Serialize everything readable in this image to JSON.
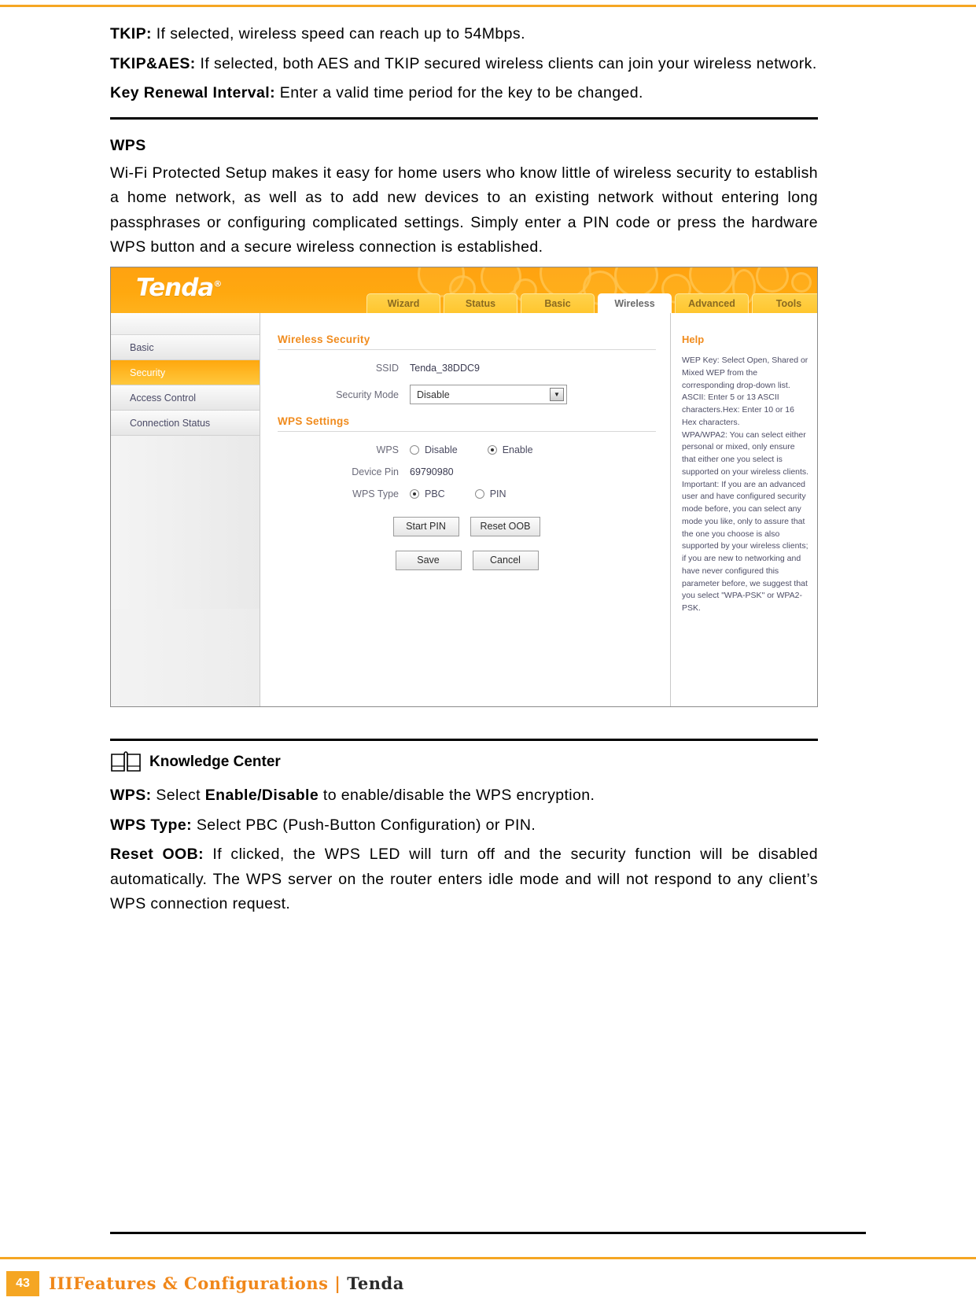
{
  "document": {
    "page_number": "43",
    "footer_prefix": "III",
    "footer_orange": "Features & Configurations",
    "footer_separator": "|",
    "footer_dark": "Tenda"
  },
  "intro": {
    "tkip_term": "TKIP:",
    "tkip_text": " If selected, wireless speed can reach up to 54Mbps.",
    "tkipaes_term": "TKIP&AES:",
    "tkipaes_text": " If selected, both AES and TKIP secured wireless clients can join your wireless network.",
    "key_renewal_term": "Key Renewal Interval:",
    "key_renewal_text": " Enter a valid time period for the key to be changed."
  },
  "wps_section": {
    "heading": "WPS",
    "body": "Wi-Fi Protected Setup makes it easy for home users who know little of wireless security to establish a home network, as well as to add new devices to an existing network without entering long passphrases or configuring complicated settings. Simply enter a PIN code or press the hardware WPS button and a secure wireless connection is established."
  },
  "router_ui": {
    "brand": "Tenda",
    "brand_mark": "®",
    "tabs": [
      {
        "label": "Wizard",
        "active": false
      },
      {
        "label": "Status",
        "active": false
      },
      {
        "label": "Basic",
        "active": false
      },
      {
        "label": "Wireless",
        "active": true
      },
      {
        "label": "Advanced",
        "active": false
      },
      {
        "label": "Tools",
        "active": false
      }
    ],
    "sidebar": [
      {
        "label": "Basic",
        "active": false
      },
      {
        "label": "Security",
        "active": true
      },
      {
        "label": "Access Control",
        "active": false
      },
      {
        "label": "Connection Status",
        "active": false
      }
    ],
    "legend_security": "Wireless Security",
    "legend_wps": "WPS Settings",
    "fields": {
      "ssid_label": "SSID",
      "ssid_value": "Tenda_38DDC9",
      "security_mode_label": "Security Mode",
      "security_mode_value": "Disable",
      "wps_label": "WPS",
      "wps_disable_label": "Disable",
      "wps_enable_label": "Enable",
      "device_pin_label": "Device Pin",
      "device_pin_value": "69790980",
      "wps_type_label": "WPS Type",
      "wps_type_pbc_label": "PBC",
      "wps_type_pin_label": "PIN"
    },
    "buttons": {
      "start_pin": "Start PIN",
      "reset_oob": "Reset OOB",
      "save": "Save",
      "cancel": "Cancel"
    },
    "help": {
      "title": "Help",
      "text": "WEP Key: Select Open, Shared or Mixed WEP from the corresponding drop-down list. ASCII: Enter 5 or 13 ASCII characters.Hex: Enter 10 or 16 Hex characters.\nWPA/WPA2: You can select either personal or mixed, only ensure that either one you select is supported on your wireless clients.\nImportant: If you are an advanced user and have configured security mode before, you can select any mode you like, only to assure that the one you choose is also supported by your wireless clients; if you are new to networking and have never configured this parameter before, we suggest that you select \"WPA-PSK\" or WPA2-PSK."
    },
    "colors": {
      "brand_orange": "#ffa80f",
      "accent_orange": "#f08b1d",
      "tab_yellow": "#ffc62e"
    }
  },
  "knowledge_center": {
    "title": "Knowledge Center",
    "items": [
      {
        "term": "WPS:",
        "text_before": " Select ",
        "bold_a": "Enable",
        "slash": "/",
        "bold_b": "Disable",
        "text_after": " to enable/disable the WPS encryption."
      },
      {
        "term": "WPS Type:",
        "text": " Select PBC (Push-Button Configuration) or PIN."
      },
      {
        "term": "Reset OOB:",
        "text": " If clicked, the WPS LED will turn off and the security function will be disabled automatically. The WPS server on the router enters idle mode and will not respond to any client’s WPS connection request."
      }
    ]
  }
}
